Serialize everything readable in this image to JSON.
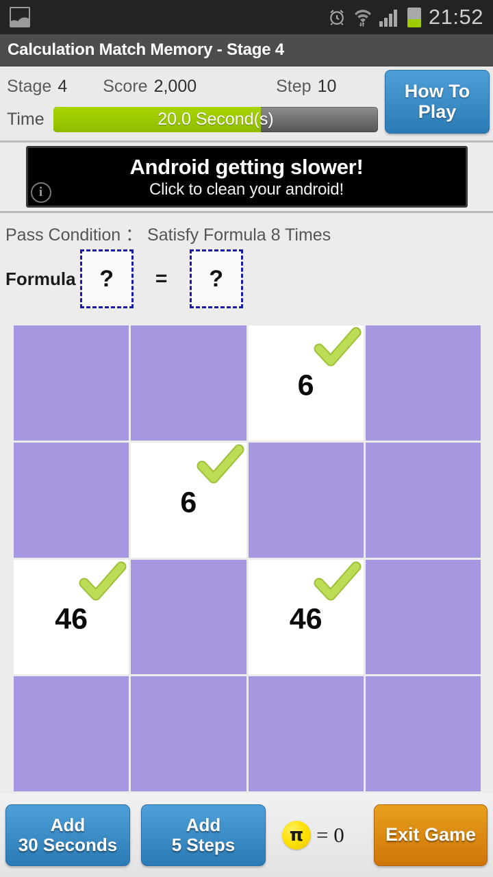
{
  "status_bar": {
    "left_icon": "gallery-icon",
    "icons": [
      "alarm-icon",
      "wifi-icon",
      "signal-icon",
      "battery-icon"
    ],
    "time": "21:52"
  },
  "title_bar": {
    "title": "Calculation Match Memory - Stage 4"
  },
  "info_panel": {
    "stage_label": "Stage",
    "stage_value": "4",
    "score_label": "Score",
    "score_value": "2,000",
    "step_label": "Step",
    "step_value": "10",
    "time_label": "Time",
    "time_bar_text": "20.0 Second(s)",
    "time_bar_fill_percent": 64,
    "time_bar_fill_color": "#a9d400",
    "how_to_play": "How To\nPlay",
    "how_to_play_line1": "How To",
    "how_to_play_line2": "Play"
  },
  "ad": {
    "line1": "Android getting slower!",
    "line2": "Click to clean your android!",
    "info_glyph": "i"
  },
  "pass_condition": {
    "text": "Pass Condition ： Satisfy Formula 8 Times"
  },
  "formula": {
    "label": "Formula",
    "left_value": "?",
    "operator": "=",
    "right_value": "?"
  },
  "grid": {
    "rows": 4,
    "cols": 4,
    "hidden_color": "#a797e0",
    "revealed_color": "#ffffff",
    "check_color": "#b6d94c",
    "cells": [
      {
        "state": "hidden",
        "value": ""
      },
      {
        "state": "hidden",
        "value": ""
      },
      {
        "state": "revealed",
        "value": "6"
      },
      {
        "state": "hidden",
        "value": ""
      },
      {
        "state": "hidden",
        "value": ""
      },
      {
        "state": "revealed",
        "value": "6"
      },
      {
        "state": "hidden",
        "value": ""
      },
      {
        "state": "hidden",
        "value": ""
      },
      {
        "state": "revealed",
        "value": "46"
      },
      {
        "state": "hidden",
        "value": ""
      },
      {
        "state": "revealed",
        "value": "46"
      },
      {
        "state": "hidden",
        "value": ""
      },
      {
        "state": "hidden",
        "value": ""
      },
      {
        "state": "hidden",
        "value": ""
      },
      {
        "state": "hidden",
        "value": ""
      },
      {
        "state": "hidden",
        "value": ""
      }
    ]
  },
  "bottom_bar": {
    "add_seconds_line1": "Add",
    "add_seconds_line2": "30 Seconds",
    "add_steps_line1": "Add",
    "add_steps_line2": "5 Steps",
    "pi_symbol": "π",
    "pi_equals": "= 0",
    "exit_game": "Exit Game",
    "blue_color": "#2a7ab5",
    "orange_color": "#cf7508"
  }
}
